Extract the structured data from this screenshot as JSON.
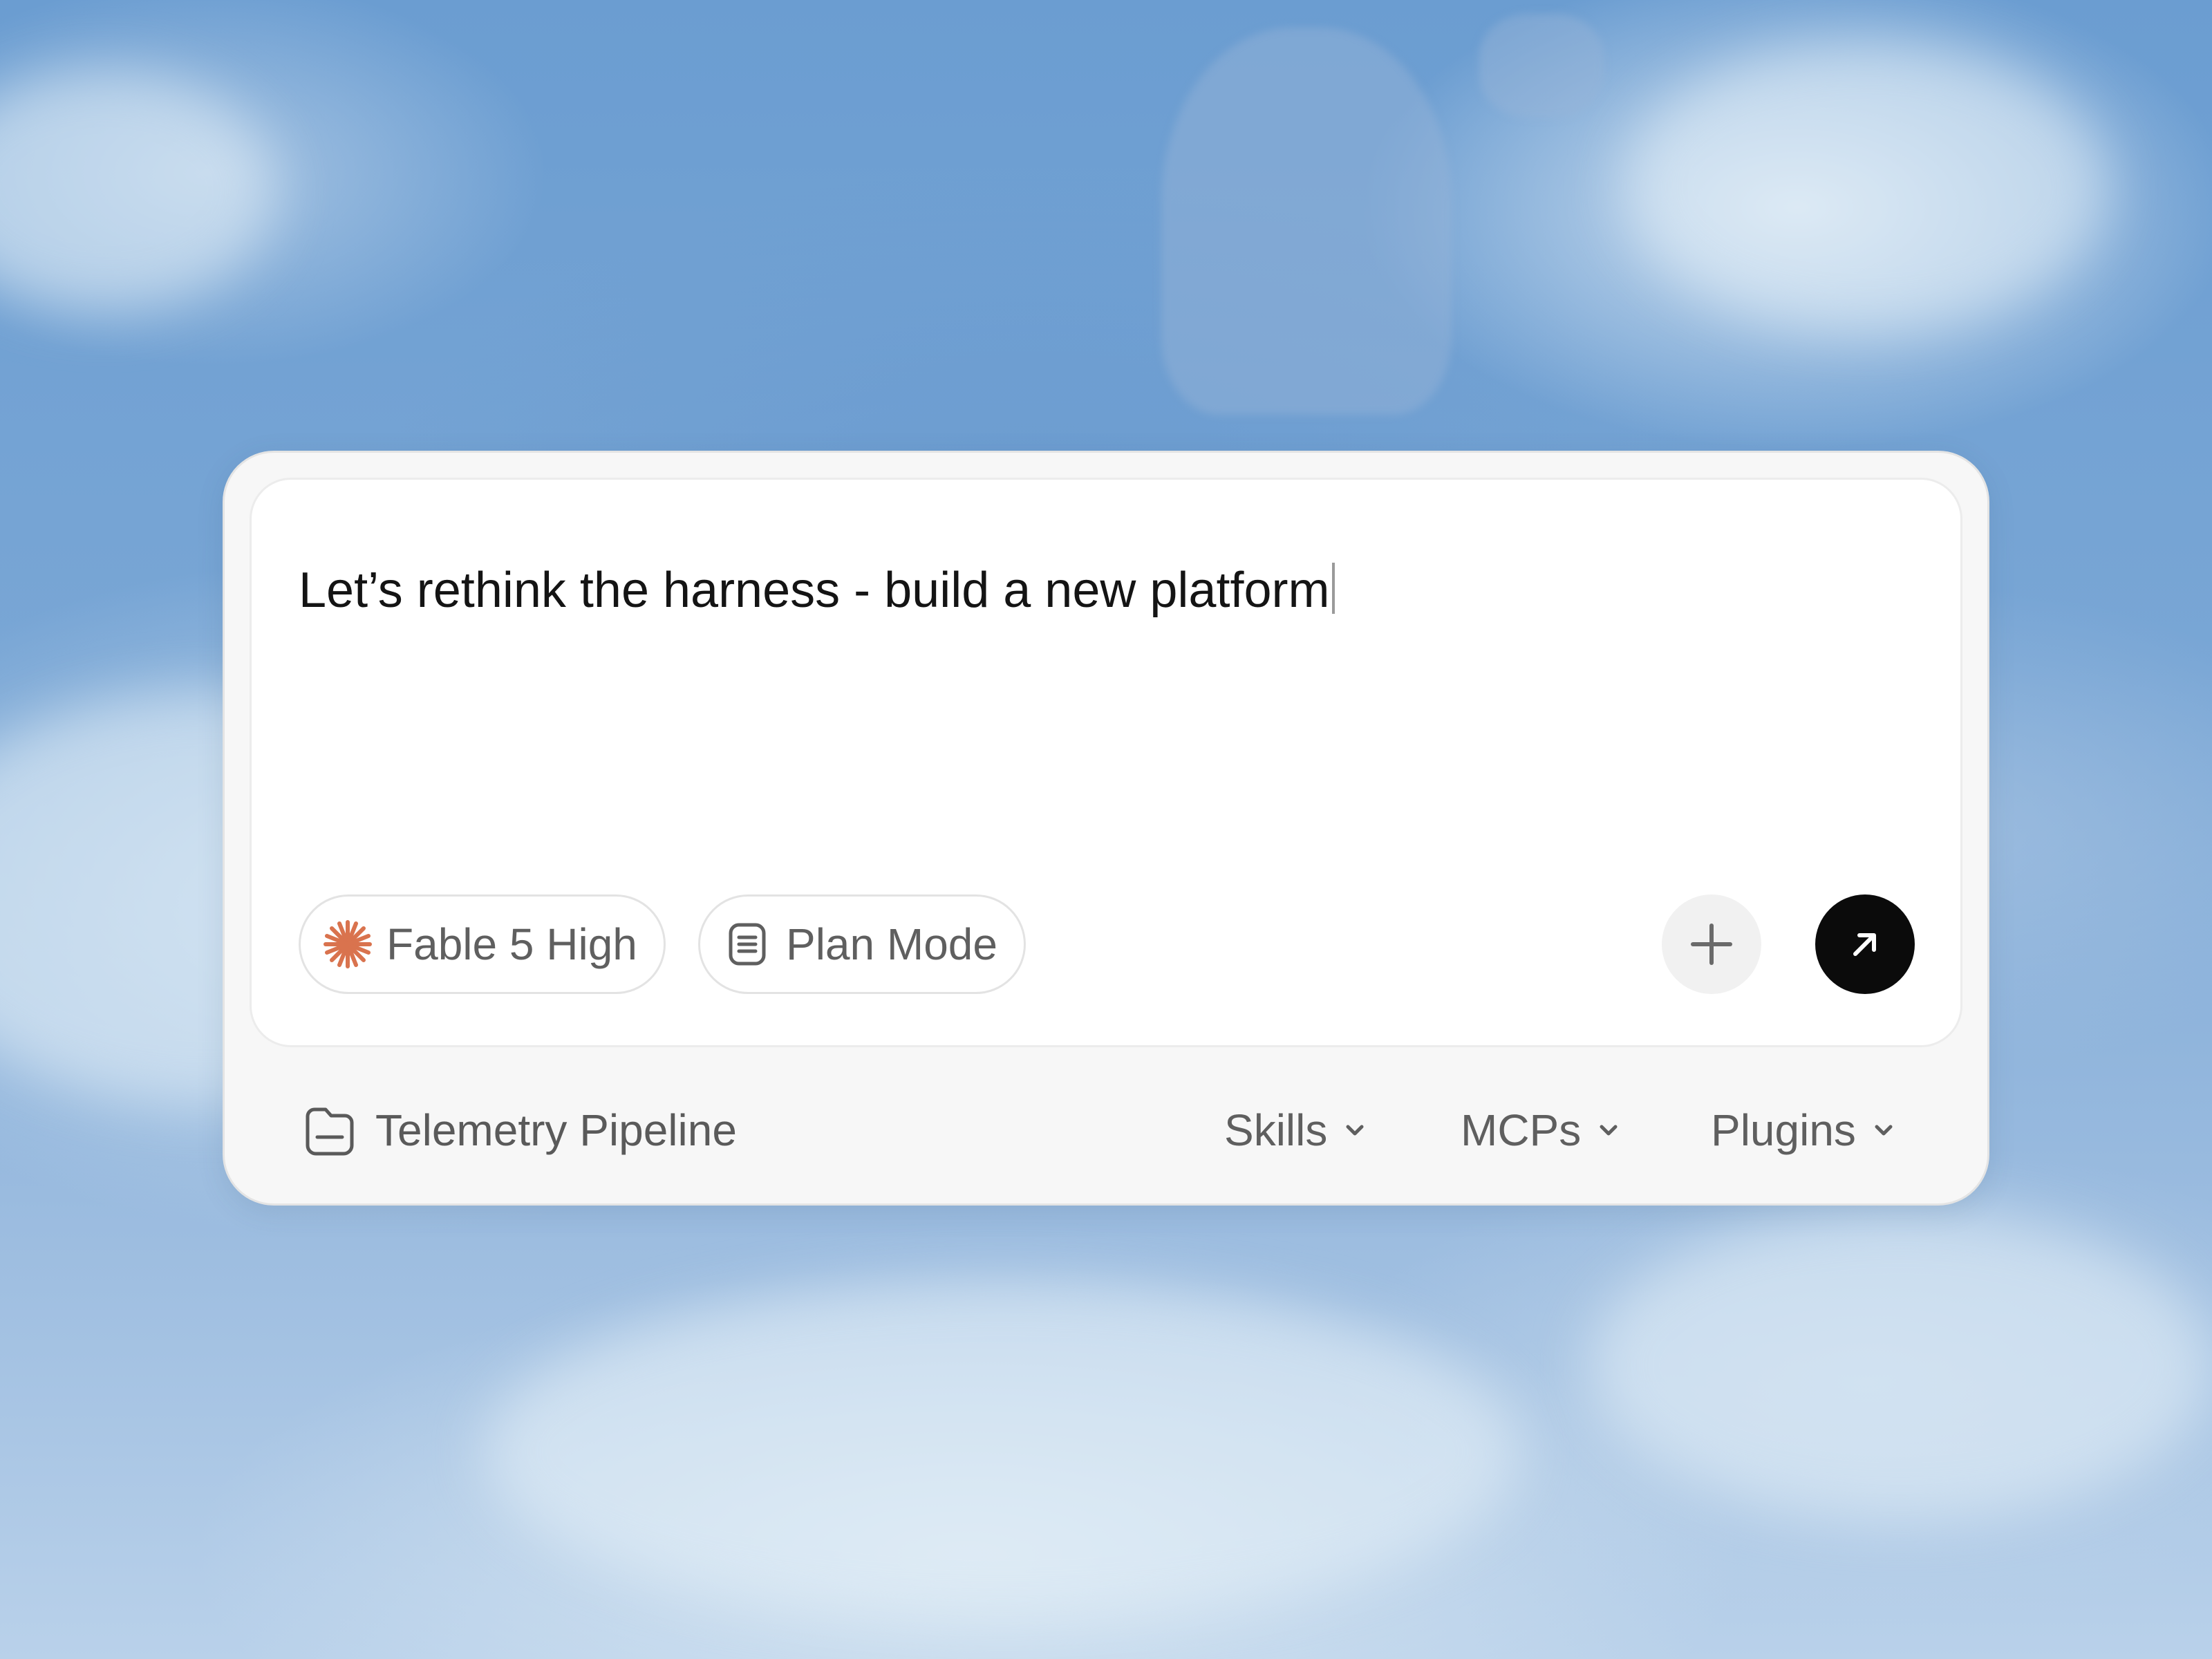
{
  "composer": {
    "prompt_text": "Let’s rethink the harness - build a new platform",
    "model": {
      "label": "Fable 5 High",
      "icon": "asterisk-icon",
      "icon_color": "#d9734e"
    },
    "mode": {
      "label": "Plan Mode",
      "icon": "document-icon"
    },
    "add_button": {
      "icon": "plus-icon"
    },
    "send_button": {
      "icon": "arrow-up-right-icon",
      "color": "#0b0b0b"
    }
  },
  "footer": {
    "project": {
      "label": "Telemetry Pipeline",
      "icon": "folder-icon"
    },
    "menus": [
      {
        "label": "Skills",
        "icon": "chevron-down-icon"
      },
      {
        "label": "MCPs",
        "icon": "chevron-down-icon"
      },
      {
        "label": "Plugins",
        "icon": "chevron-down-icon"
      }
    ]
  }
}
